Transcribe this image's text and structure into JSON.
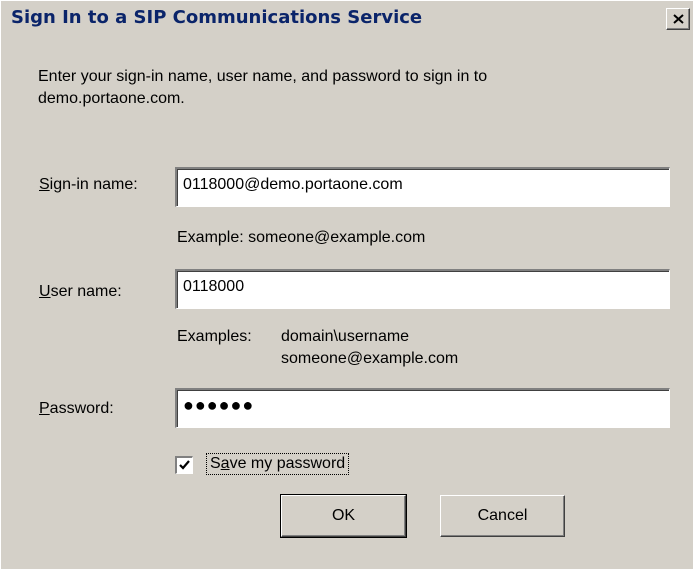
{
  "window": {
    "title": "Sign In to a SIP Communications Service"
  },
  "intro": "Enter your sign-in name, user name, and password to sign in to\ndemo.portaone.com.",
  "signin": {
    "label_accel": "S",
    "label_rest": "ign-in name:",
    "value": "0118000@demo.portaone.com",
    "hint": "Example: someone@example.com"
  },
  "username": {
    "label_accel": "U",
    "label_rest": "ser name:",
    "value": "0118000",
    "hint_prefix": "Examples:",
    "hint_line1": "domain\\username",
    "hint_line2": "someone@example.com"
  },
  "password": {
    "label_accel": "P",
    "label_rest": "assword:",
    "masked_value": "●●●●●●"
  },
  "save_password": {
    "checked": true,
    "label_pre": "S",
    "label_accel": "a",
    "label_rest": "ve my password"
  },
  "buttons": {
    "ok": "OK",
    "cancel": "Cancel"
  },
  "icons": {
    "close": "close-icon",
    "check": "checkmark-icon"
  }
}
